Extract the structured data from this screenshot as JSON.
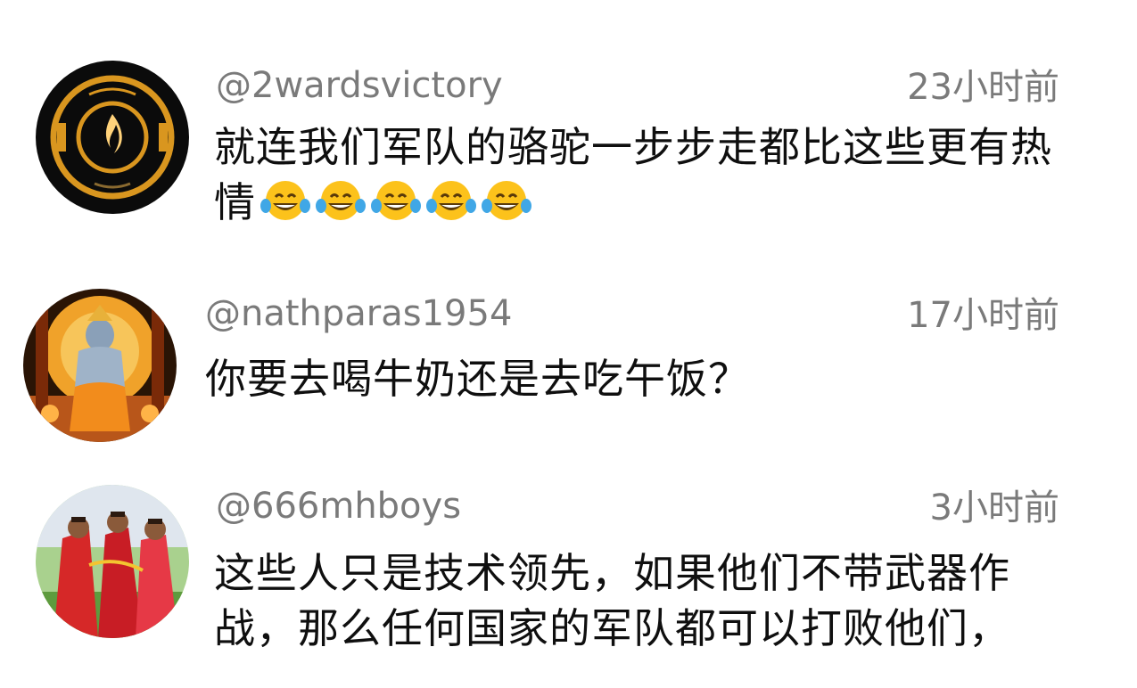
{
  "comments": [
    {
      "handle": "@2wardsvictory",
      "time": "23小时前",
      "text": "就连我们军队的骆驼一步步走都比这些更有热情",
      "emoji": "face-with-tears-of-joy",
      "emoji_count": 5,
      "avatar": "fire-emblem-avatar"
    },
    {
      "handle": "@nathparas1954",
      "time": "17小时前",
      "text": "你要去喝牛奶还是去吃午饭？",
      "avatar": "deity-portrait-avatar"
    },
    {
      "handle": "@666mhboys",
      "time": "3小时前",
      "text": "这些人只是技术领先，如果他们不带武器作战，那么任何国家的军队都可以打败他们，",
      "avatar": "red-saree-photo-avatar"
    }
  ],
  "colors": {
    "handle": "#7a7a7a",
    "text": "#0f0f0f",
    "background": "#ffffff"
  }
}
